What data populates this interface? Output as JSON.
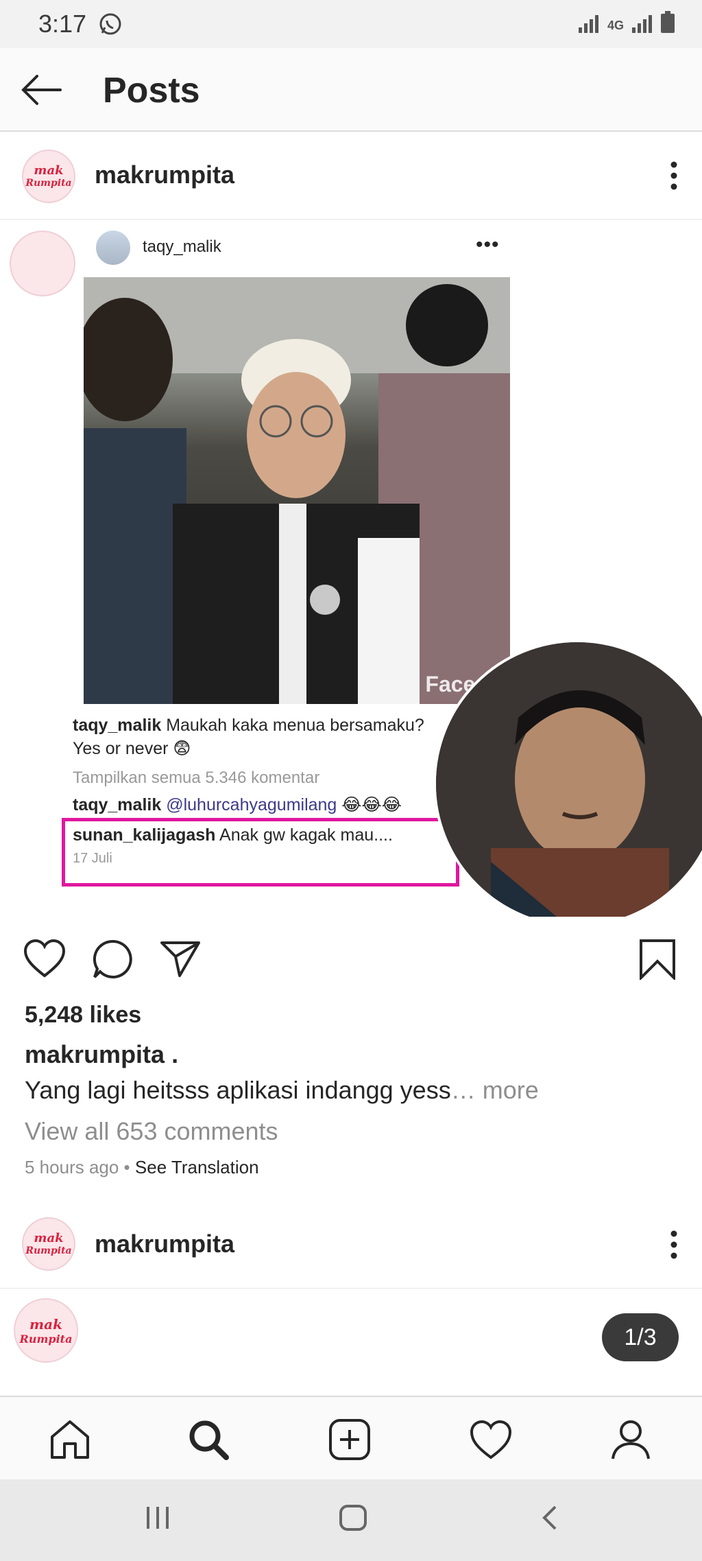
{
  "status_bar": {
    "time": "3:17",
    "network": "4G"
  },
  "header": {
    "title": "Posts"
  },
  "post": {
    "username": "makrumpita",
    "avatar_text": [
      "mak",
      "Rumpita"
    ],
    "image": {
      "source_username": "taqy_malik",
      "watermark": "FaceAp",
      "comments": [
        {
          "user": "taqy_malik",
          "text_line1": "Maukah kaka menua bersamaku?",
          "text_line2": "Yes or never 😨"
        }
      ],
      "show_all": "Tampilkan semua 5.346 komentar",
      "reply": {
        "user": "taqy_malik",
        "mention": "@luhurcahyagumilang",
        "emoji": "😂😂😂"
      },
      "highlighted": {
        "user": "sunan_kalijagash",
        "text": "Anak gw kagak mau....",
        "date": "17 Juli"
      }
    },
    "likes": "5,248 likes",
    "caption_user": "makrumpita .",
    "caption_text": "Yang lagi heitsss aplikasi indangg yess",
    "caption_more": "… more",
    "view_comments": "View all 653 comments",
    "time_ago": "5 hours ago",
    "separator": " • ",
    "see_translation": "See Translation"
  },
  "next_post": {
    "username": "makrumpita",
    "page_indicator": "1/3"
  },
  "bottom_nav": {
    "icons": [
      "home-icon",
      "search-icon",
      "new-post-icon",
      "activity-heart-icon",
      "profile-icon"
    ]
  },
  "colors": {
    "highlight_border": "#e0179e",
    "brand_red": "#d8233f"
  }
}
